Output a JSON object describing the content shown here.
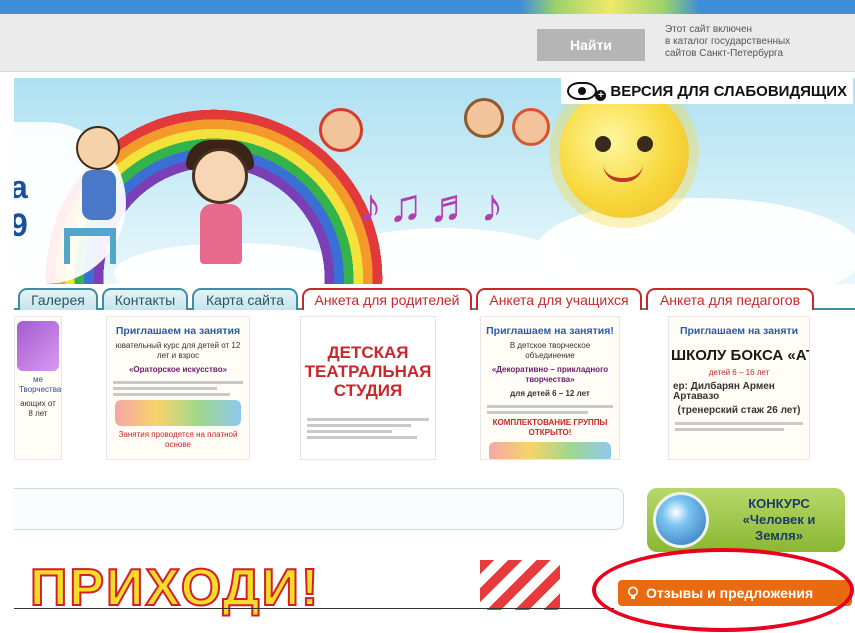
{
  "header": {
    "search_button": "Найти",
    "catalog_note": [
      "Этот сайт включен",
      "в каталог государственных",
      "сайтов Санкт-Петербурга"
    ]
  },
  "banner": {
    "vision_label": "ВЕРСИЯ ДЛЯ СЛАБОВИДЯЩИХ",
    "partial_title_line1": "а",
    "partial_title_line2": "9"
  },
  "nav": {
    "tabs": [
      "Галерея",
      "Контакты",
      "Карта сайта"
    ],
    "survey_tabs": [
      "Анкета для родителей",
      "Анкета для учащихся",
      "Анкета для педагогов"
    ]
  },
  "ads": [
    {
      "title": "",
      "sub": "ме Творчества",
      "extra": "ающих от 8 лет"
    },
    {
      "title": "Приглашаем на занятия",
      "sub": "ювательный курс для детей от 12 лет и взрос",
      "name": "«Ораторское искусство»",
      "footer": "Занятия проводятся на платной основе"
    },
    {
      "title": "ДЕТСКАЯ ТЕАТРАЛЬНАЯ СТУДИЯ"
    },
    {
      "title": "Приглашаем на занятия!",
      "sub": "В детское творческое объединение",
      "name": "«Декоративно – прикладного творчества»",
      "extra": "для детей 6 – 12 лет",
      "footer": "КОМПЛЕКТОВАНИЕ ГРУППЫ ОТКРЫТО!"
    },
    {
      "title": "Приглашаем на заняти",
      "name": "ШКОЛУ БОКСА «АТАМА",
      "sub": "детей 6 – 16 лет",
      "extra": "ер: Дилбарян Армен Артавазо",
      "footer": "(тренерский стаж 26 лет)"
    }
  ],
  "contest": {
    "line1": "КОНКУРС",
    "line2": "«Человек и",
    "line3": "Земля»"
  },
  "promo": {
    "headline": "ПРИХОДИ!"
  },
  "feedback": {
    "label": "Отзывы и предложения"
  },
  "colors": {
    "accent_orange": "#ea6a10",
    "tab_teal": "#3c8ea3",
    "survey_red": "#c9272a",
    "highlight_oval": "#e8001c"
  }
}
